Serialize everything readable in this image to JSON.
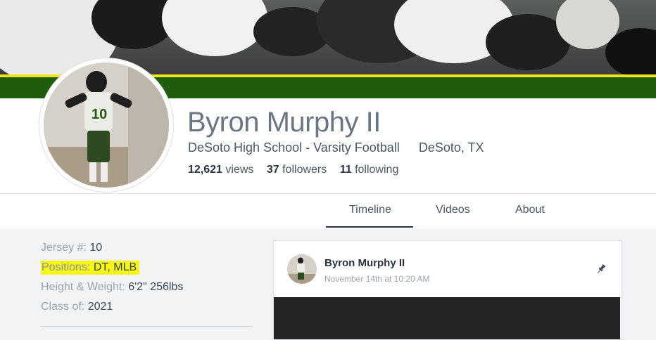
{
  "profile": {
    "name": "Byron Murphy II",
    "school": "DeSoto High School - Varsity Football",
    "location": "DeSoto, TX",
    "stats": [
      {
        "value": "12,621",
        "label": "views"
      },
      {
        "value": "37",
        "label": "followers"
      },
      {
        "value": "11",
        "label": "following"
      }
    ]
  },
  "tabs": [
    "Timeline",
    "Videos",
    "About"
  ],
  "active_tab": "Timeline",
  "info": {
    "jersey": {
      "label": "Jersey #:",
      "value": "10"
    },
    "positions": {
      "label": "Positions:",
      "value": "DT, MLB"
    },
    "height_weight": {
      "label": "Height & Weight:",
      "value": "6'2\" 256lbs"
    },
    "class_of": {
      "label": "Class of:",
      "value": "2021"
    }
  },
  "post": {
    "author": "Byron Murphy II",
    "timestamp": "November 14th at 10:20 AM",
    "icon": "pin-icon"
  },
  "colors": {
    "brand_green": "#1f5c0c",
    "brand_yellow": "#f4e31b",
    "highlight": "#f8f51a"
  }
}
